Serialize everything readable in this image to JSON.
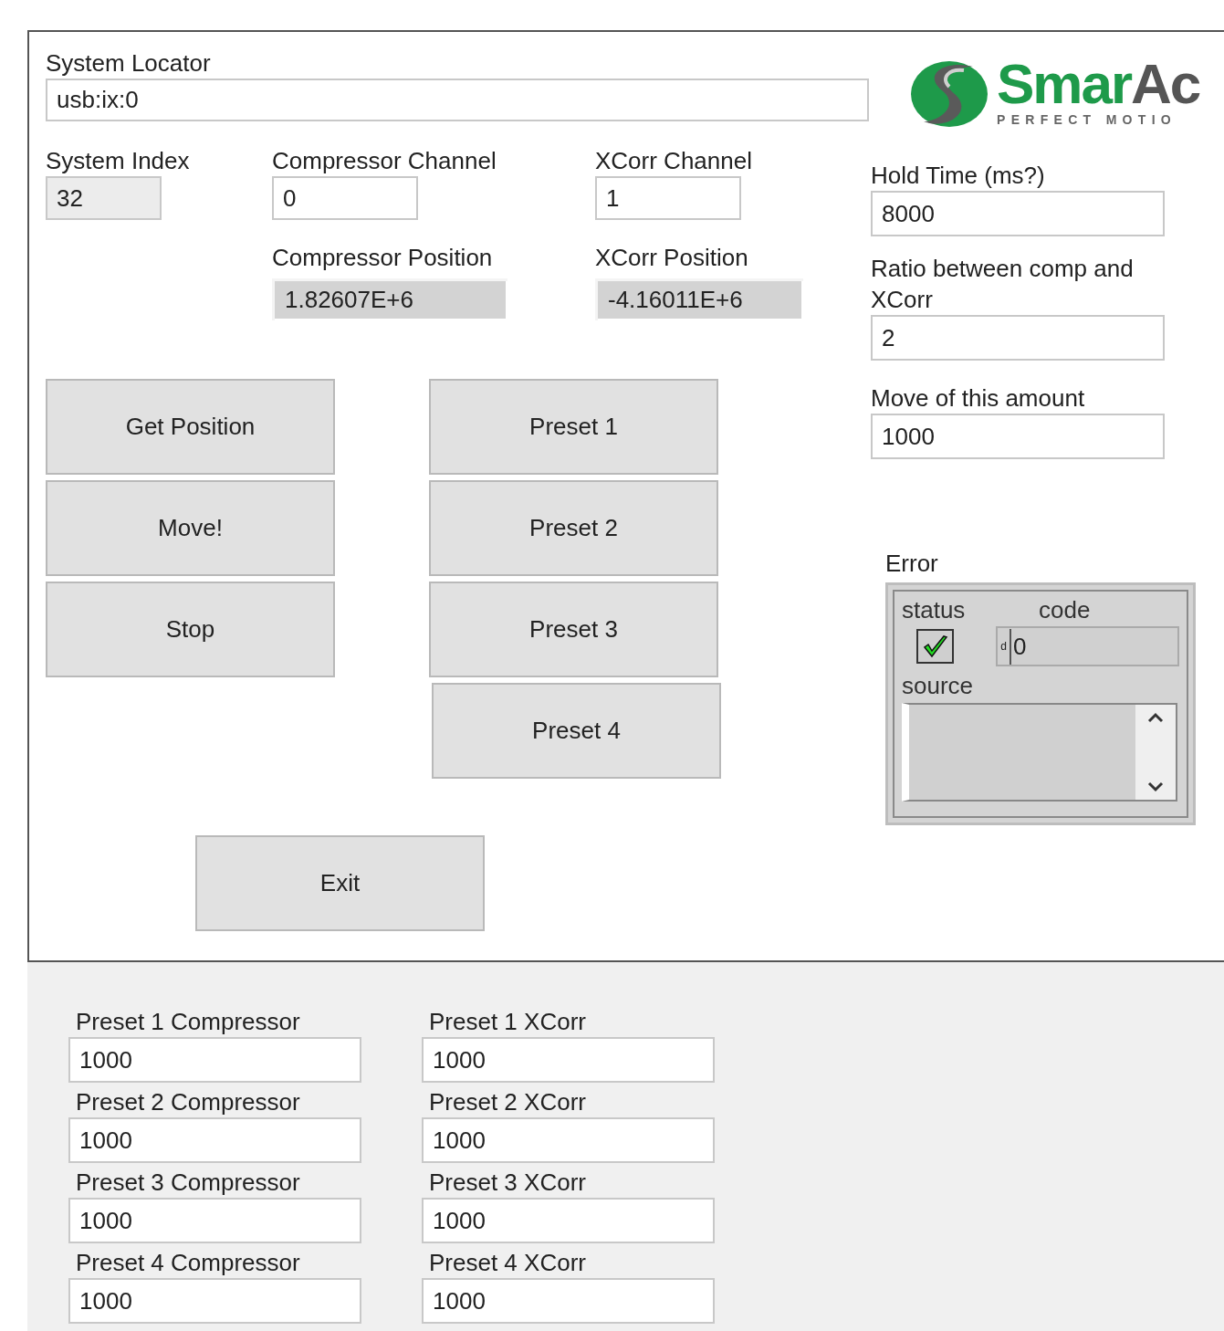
{
  "system_locator": {
    "label": "System Locator",
    "value": "usb:ix:0"
  },
  "logo": {
    "brand_primary": "Smar",
    "brand_secondary": "Ac",
    "tagline": "PERFECT MOTIO"
  },
  "system_index": {
    "label": "System Index",
    "value": "32"
  },
  "compressor_channel": {
    "label": "Compressor Channel",
    "value": "0"
  },
  "xcorr_channel": {
    "label": "XCorr Channel",
    "value": "1"
  },
  "compressor_position": {
    "label": "Compressor Position",
    "value": "1.82607E+6"
  },
  "xcorr_position": {
    "label": "XCorr Position",
    "value": "-4.16011E+6"
  },
  "hold_time": {
    "label": "Hold Time (ms?)",
    "value": "8000"
  },
  "ratio": {
    "label": "Ratio between comp and XCorr",
    "value": "2"
  },
  "move_amount": {
    "label": "Move of this amount",
    "value": "1000"
  },
  "action_buttons": [
    "Get Position",
    "Move!",
    "Stop"
  ],
  "preset_buttons": [
    "Preset 1",
    "Preset 2",
    "Preset 3",
    "Preset 4"
  ],
  "exit_button": "Exit",
  "error": {
    "label": "Error",
    "status_label": "status",
    "status_ok": true,
    "code_label": "code",
    "radix": "d",
    "code": "0",
    "source_label": "source"
  },
  "presets": [
    {
      "compressor_label": "Preset 1 Compressor",
      "compressor_value": "1000",
      "xcorr_label": "Preset 1 XCorr",
      "xcorr_value": "1000"
    },
    {
      "compressor_label": "Preset 2 Compressor",
      "compressor_value": "1000",
      "xcorr_label": "Preset 2 XCorr",
      "xcorr_value": "1000"
    },
    {
      "compressor_label": "Preset 3 Compressor",
      "compressor_value": "1000",
      "xcorr_label": "Preset 3 XCorr",
      "xcorr_value": "1000"
    },
    {
      "compressor_label": "Preset 4 Compressor",
      "compressor_value": "1000",
      "xcorr_label": "Preset 4 XCorr",
      "xcorr_value": "1000"
    }
  ]
}
